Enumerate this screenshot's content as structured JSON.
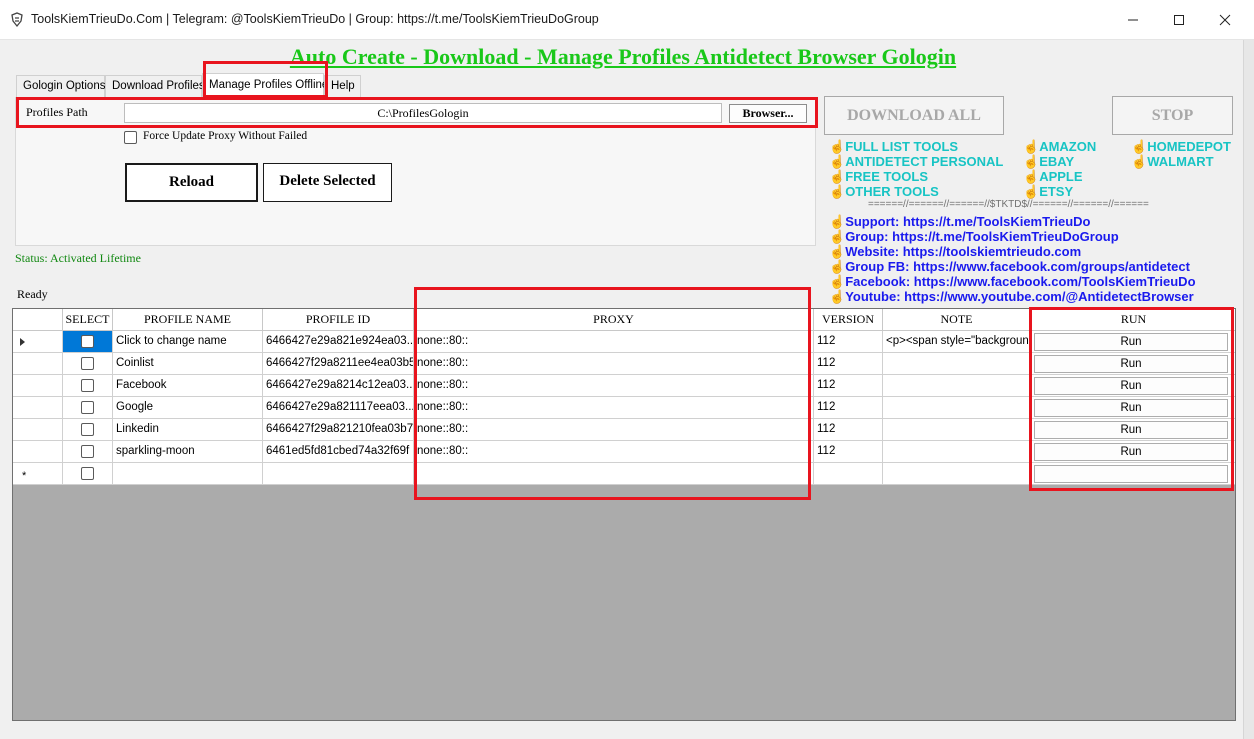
{
  "window": {
    "title": "ToolsKiemTrieuDo.Com | Telegram: @ToolsKiemTrieuDo | Group: https://t.me/ToolsKiemTrieuDoGroup"
  },
  "main_title": "Auto Create - Download - Manage Profiles Antidetect Browser Gologin",
  "tabs": [
    {
      "label": "Gologin Options"
    },
    {
      "label": "Download Profiles"
    },
    {
      "label": "Manage Profiles Offline"
    },
    {
      "label": "Help"
    }
  ],
  "profiles_path": {
    "label": "Profiles Path",
    "value": "C:\\ProfilesGologin",
    "browse_label": "Browser..."
  },
  "force_update": {
    "label": "Force Update Proxy Without Failed",
    "checked": false
  },
  "buttons": {
    "reload": "Reload",
    "delete_selected": "Delete Selected",
    "download_all": "DOWNLOAD ALL",
    "stop": "STOP"
  },
  "status": "Status: Activated Lifetime",
  "ready": "Ready",
  "tool_links": {
    "hand": "☝",
    "col1": [
      "FULL LIST TOOLS",
      "ANTIDETECT PERSONAL",
      "FREE TOOLS",
      "OTHER TOOLS"
    ],
    "col2": [
      "AMAZON",
      "EBAY",
      "APPLE",
      "ETSY"
    ],
    "col3": [
      "HOMEDEPOT",
      "WALMART"
    ]
  },
  "separator": "======//======//======//$TKTD$//======//======//======",
  "info_links": [
    "Support: https://t.me/ToolsKiemTrieuDo",
    "Group: https://t.me/ToolsKiemTrieuDoGroup",
    "Website: https://toolskiemtrieudo.com",
    "Group FB: https://www.facebook.com/groups/antidetect",
    "Facebook: https://www.facebook.com/ToolsKiemTrieuDo",
    "Youtube: https://www.youtube.com/@AntidetectBrowser"
  ],
  "grid": {
    "columns": [
      "SELECT",
      "PROFILE NAME",
      "PROFILE ID",
      "PROXY",
      "VERSION",
      "NOTE",
      "RUN"
    ],
    "rows": [
      {
        "name": "Click to change name",
        "id": "6466427e29a821e924ea03...",
        "proxy": "none::80::",
        "version": "112",
        "note": "<p><span style=\"backgroun...",
        "run": "Run",
        "current": true
      },
      {
        "name": "Coinlist",
        "id": "6466427f29a8211ee4ea03b5",
        "proxy": "none::80::",
        "version": "112",
        "note": "",
        "run": "Run"
      },
      {
        "name": "Facebook",
        "id": "6466427e29a8214c12ea03...",
        "proxy": "none::80::",
        "version": "112",
        "note": "",
        "run": "Run"
      },
      {
        "name": "Google",
        "id": "6466427e29a821117eea03...",
        "proxy": "none::80::",
        "version": "112",
        "note": "",
        "run": "Run"
      },
      {
        "name": "Linkedin",
        "id": "6466427f29a821210fea03b7",
        "proxy": "none::80::",
        "version": "112",
        "note": "",
        "run": "Run"
      },
      {
        "name": "sparkling-moon",
        "id": "6461ed5fd81cbed74a32f69f",
        "proxy": "none::80::",
        "version": "112",
        "note": "",
        "run": "Run"
      }
    ],
    "new_row_marker": "*"
  }
}
